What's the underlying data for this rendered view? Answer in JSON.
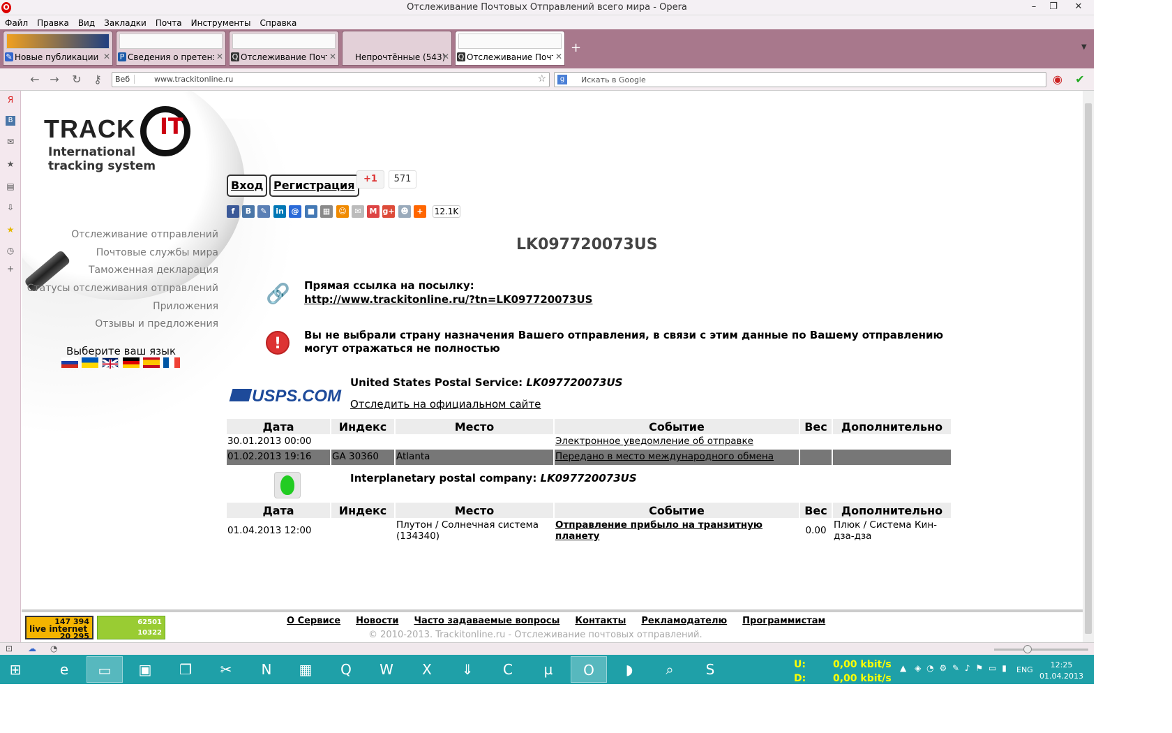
{
  "window": {
    "title": "Отслеживание Почтовых Отправлений всего мира - Opera",
    "min": "–",
    "max": "❐",
    "close": "✕"
  },
  "menu": [
    "Файл",
    "Правка",
    "Вид",
    "Закладки",
    "Почта",
    "Инструменты",
    "Справка"
  ],
  "tabs": [
    {
      "label": "Новые публикации - ...",
      "active": false
    },
    {
      "label": "Сведения о претензи...",
      "active": false
    },
    {
      "label": "Отслеживание Почто...",
      "active": false
    },
    {
      "label": "Непрочтённые (543)",
      "active": false
    },
    {
      "label": "Отслеживание Почто...",
      "active": true
    }
  ],
  "addressbar": {
    "badge": "Веб",
    "url": "www.trackitonline.ru"
  },
  "search": {
    "placeholder": "Искать в Google"
  },
  "logo": {
    "track": "TRACK",
    "it": "IT",
    "sub1": "International",
    "sub2": "tracking system"
  },
  "leftnav": [
    "Отслеживание отправлений",
    "Почтовые службы мира",
    "Таможенная декларация",
    "Статусы отслеживания отправлений",
    "Приложения",
    "Отзывы и предложения"
  ],
  "lang_label": "Выберите ваш язык",
  "auth": {
    "login": "Вход",
    "register": "Регистрация",
    "gplus": "+1",
    "gplus_count": "571"
  },
  "share_count": "12.1K",
  "tracking_number": "LK097720073US",
  "direct_link": {
    "label": "Прямая ссылка на посылку:",
    "url": "http://www.trackitonline.ru/?tn=LK097720073US"
  },
  "warning": "Вы не выбрали страну назначения Вашего отправления, в связи с этим данные по Вашему отправлению могут отражаться не полностью",
  "usps": {
    "logo": "USPS.COM",
    "service": "United States Postal Service:",
    "number": "LK097720073US",
    "official_link": "Отследить на официальном сайте"
  },
  "columns": [
    "Дата",
    "Индекс",
    "Место",
    "Событие",
    "Вес",
    "Дополнительно"
  ],
  "usps_rows": [
    {
      "date": "30.01.2013 00:00",
      "index": "",
      "place": "",
      "event": "Электронное уведомление об отправке",
      "weight": "",
      "extra": ""
    },
    {
      "date": "01.02.2013 19:16",
      "index": "GA 30360",
      "place": "Atlanta",
      "event": "Передано в место международного обмена",
      "weight": "",
      "extra": ""
    }
  ],
  "ipc": {
    "service": "Interplanetary postal company:",
    "number": "LK097720073US"
  },
  "ipc_rows": [
    {
      "date": "01.04.2013 12:00",
      "index": "",
      "place": "Плутон / Солнечная система (134340)",
      "event": "Отправление прибыло на транзитную планету",
      "weight": "0.00",
      "extra": "Плюк / Система Кин-дза-дза"
    }
  ],
  "counters": {
    "li_top": "147 394",
    "li_name": "live internet",
    "li_bottom": "20 295",
    "c2_top": "62501",
    "c2_bottom": "10322"
  },
  "footer_links": [
    "О Сервисе",
    "Новости",
    "Часто задаваемые вопросы",
    "Контакты",
    "Рекламодателю",
    "Программистам"
  ],
  "copyright": "© 2010-2013. Trackitonline.ru - Отслеживание почтовых отправлений.",
  "taskbar": {
    "net_u_label": "U:",
    "net_d_label": "D:",
    "net_u": "0,00 kbit/s",
    "net_d": "0,00 kbit/s",
    "lang": "ENG",
    "time": "12:25",
    "date": "01.04.2013"
  }
}
